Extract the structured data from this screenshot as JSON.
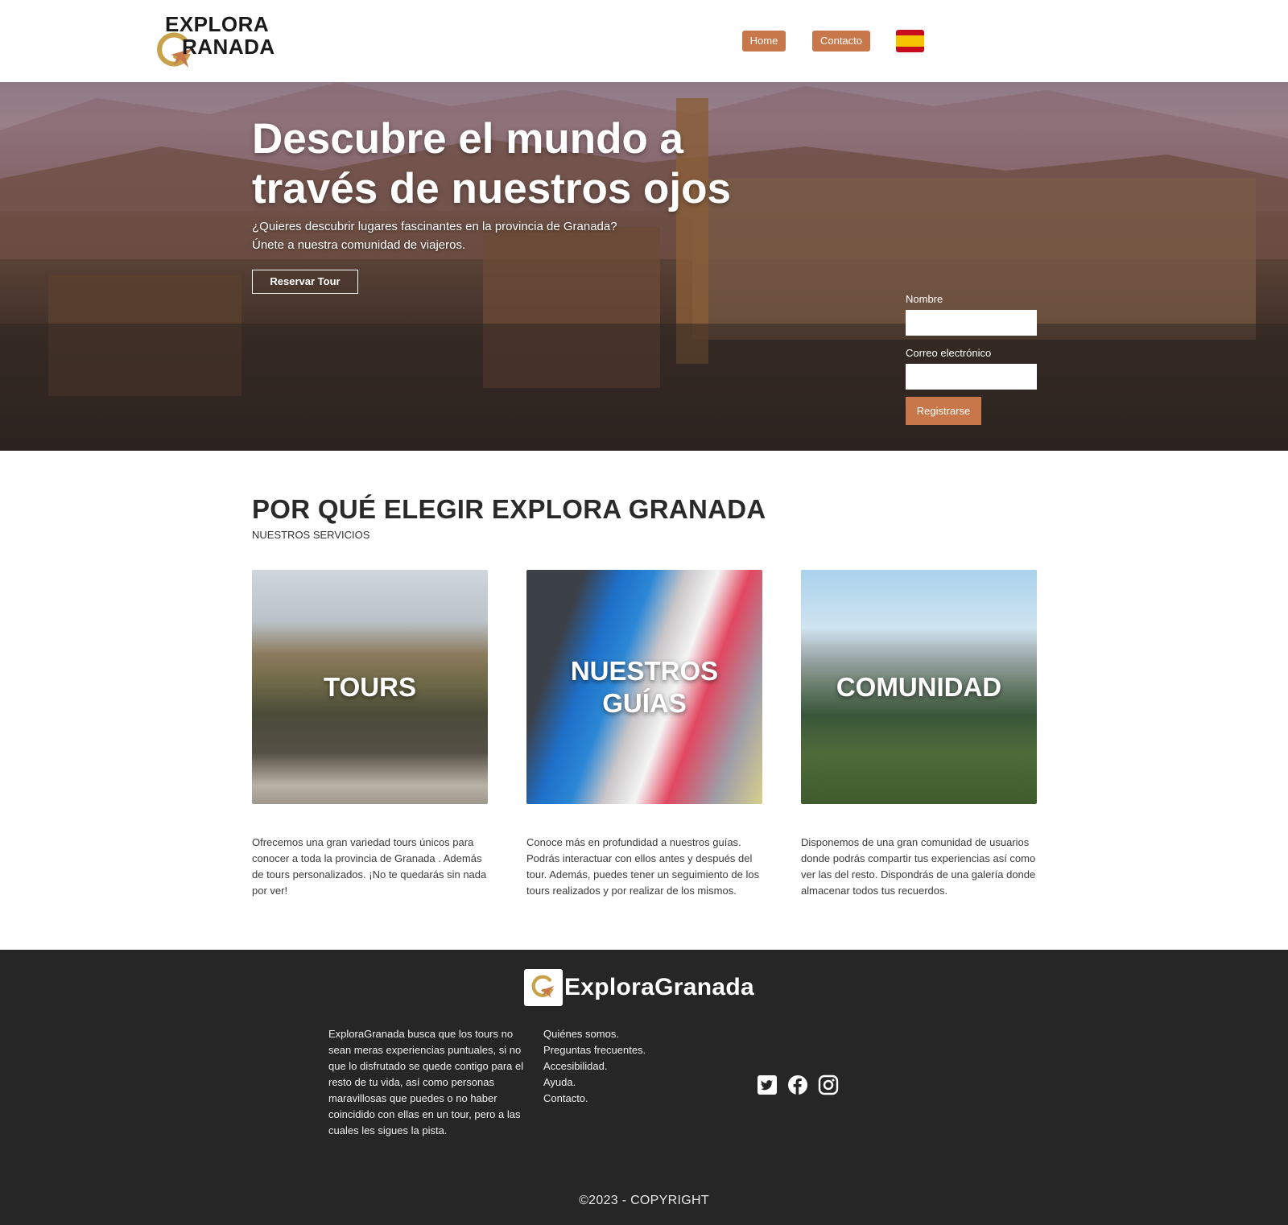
{
  "header": {
    "logo_line1": "EXPLORA",
    "logo_line2": "RANADA",
    "nav": {
      "home": "Home",
      "contacto": "Contacto"
    },
    "language_flag": "spain-flag-icon"
  },
  "hero": {
    "title": "Descubre el mundo a través de nuestros ojos",
    "subtitle_line1": "¿Quieres descubrir lugares fascinantes en la provincia de Granada?",
    "subtitle_line2": "Únete a nuestra comunidad de viajeros.",
    "cta": "Reservar Tour",
    "form": {
      "name_label": "Nombre",
      "name_value": "",
      "email_label": "Correo electrónico",
      "email_value": "",
      "submit": "Registrarse"
    }
  },
  "services": {
    "title": "POR QUÉ ELEGIR EXPLORA GRANADA",
    "subtitle": "NUESTROS SERVICIOS",
    "cards": [
      {
        "caption": "TOURS",
        "description": "Ofrecemos una gran variedad tours únicos para conocer a toda la provincia de Granada . Además de tours personalizados. ¡No te quedarás sin nada por ver!"
      },
      {
        "caption": "NUESTROS GUÍAS",
        "description": "Conoce más en profundidad a nuestros guías. Podrás interactuar con ellos antes y después del tour. Además, puedes tener un seguimiento de los tours realizados y por realizar de los mismos."
      },
      {
        "caption": "COMUNIDAD",
        "description": "Disponemos de una gran comunidad de usuarios donde podrás compartir tus experiencias así como ver las del resto. Dispondrás de una galería donde almacenar todos tus recuerdos."
      }
    ]
  },
  "footer": {
    "brand": "ExploraGranada",
    "about": "ExploraGranada busca que los tours no sean meras experiencias puntuales, si no que lo disfrutado se quede contigo para el resto de tu vida, así como personas maravillosas que puedes o no haber coincidido con ellas en un tour, pero a las cuales les sigues la pista.",
    "links": [
      "Quiénes somos.",
      "Preguntas frecuentes.",
      "Accesibilidad.",
      "Ayuda.",
      "Contacto."
    ],
    "social": [
      "twitter-icon",
      "facebook-icon",
      "instagram-icon"
    ],
    "copyright": "©2023 - COPYRIGHT"
  },
  "colors": {
    "accent": "#c8774a",
    "footer_bg": "#262626",
    "logo_gold": "#c8a24a"
  }
}
